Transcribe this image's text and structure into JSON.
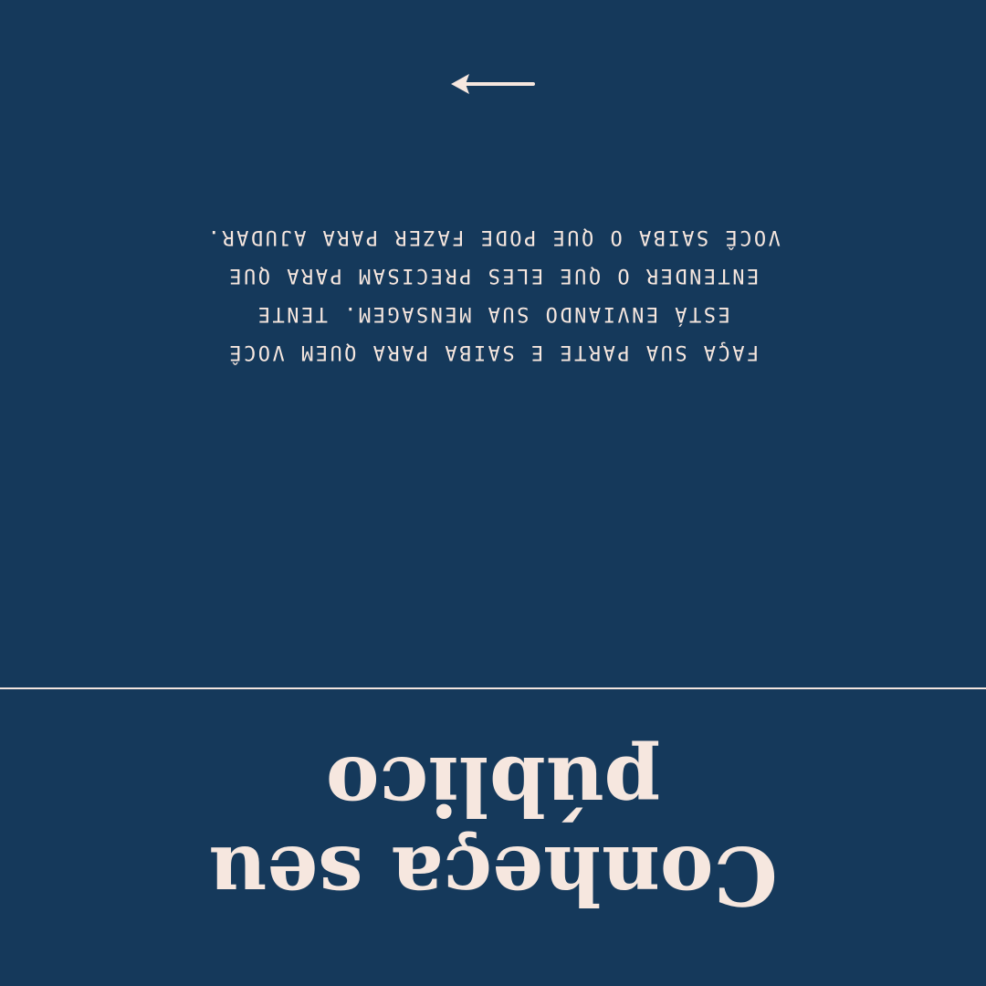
{
  "slide": {
    "title_lines": [
      "Conheça seu",
      "público"
    ],
    "body_lines": [
      "FAÇA SUA PARTE E SAIBA PARA QUEM VOCÊ",
      "ESTÁ ENVIANDO SUA MENSAGEM. TENTE",
      "ENTENDER O QUE ELES PRECISAM PARA QUE",
      "VOCÊ SAIBA O QUE PODE FAZER PARA AJUDAR."
    ],
    "arrow_icon": "arrow-right-icon"
  },
  "colors": {
    "background": "#15395b",
    "text": "#f6e7df",
    "divider": "#f2e5df"
  }
}
